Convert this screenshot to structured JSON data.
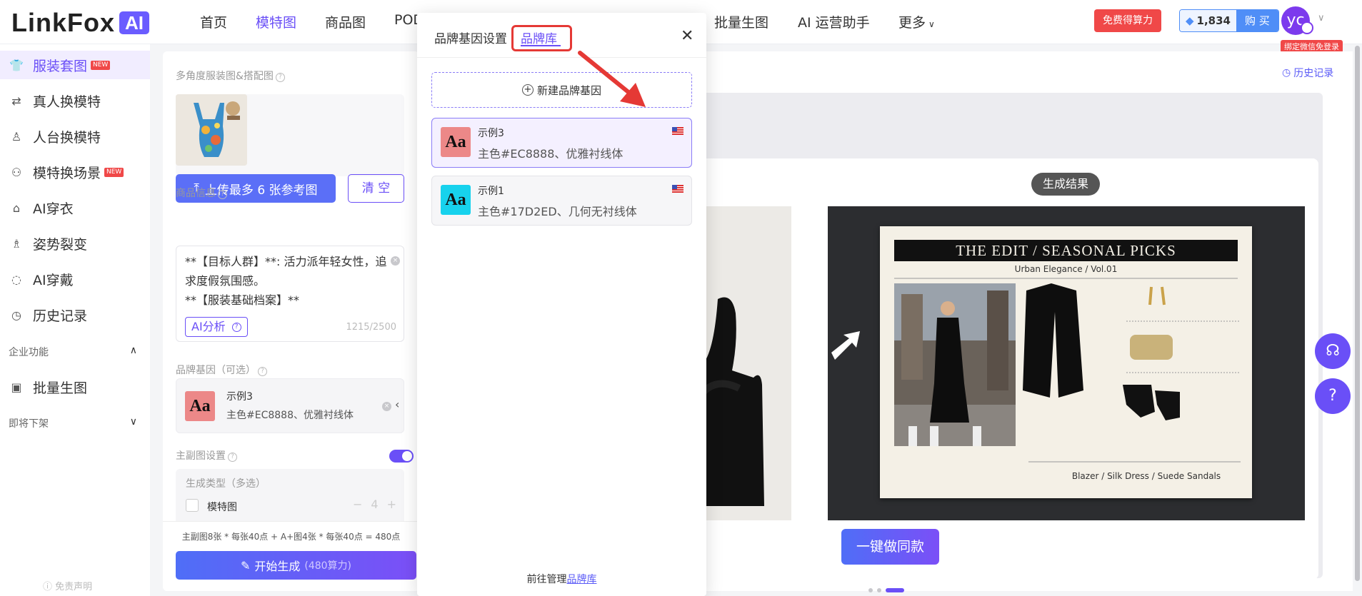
{
  "header": {
    "logo_text": "LinkFox",
    "logo_badge": "AI",
    "nav": [
      "首页",
      "模特图",
      "商品图",
      "POD",
      "批量生图",
      "AI 运营助手",
      "更多"
    ],
    "free_points_btn": "免费得算力",
    "points": "1,834",
    "buy_btn": "购 买",
    "avatar_text": "yc",
    "bind_wechat_tip": "绑定微信免登录"
  },
  "sidebar": {
    "items": [
      {
        "label": "服装套图",
        "badge": "NEW",
        "icon": "shirt-icon"
      },
      {
        "label": "真人换模特",
        "icon": "person-swap-icon"
      },
      {
        "label": "人台换模特",
        "icon": "mannequin-icon"
      },
      {
        "label": "模特换场景",
        "badge": "NEW",
        "icon": "scene-icon"
      },
      {
        "label": "AI穿衣",
        "icon": "hanger-icon"
      },
      {
        "label": "姿势裂变",
        "icon": "pose-icon"
      },
      {
        "label": "AI穿戴",
        "icon": "accessory-icon"
      },
      {
        "label": "历史记录",
        "icon": "clock-icon"
      }
    ],
    "group_enterprise": "企业功能",
    "batch_item": "批量生图",
    "group_coming": "即将下架",
    "disclaimer": "免责声明"
  },
  "form": {
    "multi_angle_label": "多角度服装图&搭配图",
    "upload_btn": "上传最多 6 张参考图",
    "clear_btn": "清 空",
    "product_info_label": "商品信息",
    "product_info_lines": [
      "**【目标人群】**: 活力派年轻女性，追求度假氛围感。",
      "**【服装基础档案】**"
    ],
    "ai_analyze_btn": "AI分析",
    "char_count": "1215/2500",
    "brand_gene_label": "品牌基因（可选）",
    "selected_brand": {
      "name": "示例3",
      "desc": "主色#EC8888、优雅衬线体",
      "swatch": "#EC8888"
    },
    "main_image_settings_label": "主副图设置",
    "gen_type_label": "生成类型（多选）",
    "gen_type_option": "模特图",
    "gen_type_count": "4",
    "cost_formula": "主副图8张 * 每张40点 + A+图4张 * 每张40点 = 480点",
    "generate_btn": "开始生成",
    "generate_cost": "(480算力)"
  },
  "main": {
    "history_link": "历史记录",
    "result_label": "生成结果",
    "board_title": "THE EDIT / SEASONAL PICKS",
    "board_subtitle": "Urban Elegance / Vol.01",
    "board_caption": "Blazer / Silk Dress / Suede Sandals",
    "same_style_btn": "一键做同款"
  },
  "modal": {
    "tab_brand_gene": "品牌基因设置",
    "tab_brand_lib": "品牌库",
    "new_brand_btn": "新建品牌基因",
    "brands": [
      {
        "name": "示例3",
        "desc": "主色#EC8888、优雅衬线体",
        "swatch": "#EC8888",
        "selected": true
      },
      {
        "name": "示例1",
        "desc": "主色#17D2ED、几何无衬线体",
        "swatch": "#17D2ED",
        "selected": false
      }
    ],
    "footer_text": "前往管理",
    "footer_link": "品牌库"
  },
  "colors": {
    "accent": "#6a4ff7",
    "danger": "#f04848",
    "link": "#5b5bf7"
  }
}
